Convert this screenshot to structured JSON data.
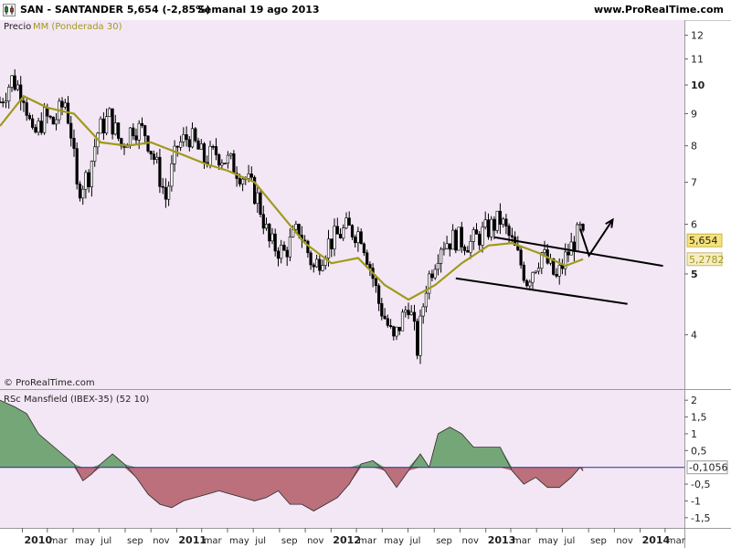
{
  "header": {
    "title": "SAN - SANTANDER    5,654 (-2,85%)",
    "period": "Semanal  19 ago 2013",
    "site": "www.ProRealTime.com"
  },
  "colors": {
    "price_bg": "#f3e7f5",
    "indicator_bg": "#f3e7f5",
    "ma": "#a09a1a",
    "candle": "#000000",
    "rs_pos": "#5e9a62",
    "rs_neg": "#b05a66",
    "zero_line": "#2a2a9a",
    "price_box": "#f5e27a",
    "ma_box": "#f6ecc6"
  },
  "price_panel": {
    "legend_prefix": "Precio",
    "legend_ma": "MM (Ponderada 30)",
    "copyright": "© ProRealTime.com",
    "last_price_label": "5,654",
    "last_ma_label": "5,2782"
  },
  "indicator_panel": {
    "legend": "RSc Mansfield (IBEX-35) (52 10)",
    "last_value_label": "-0,1056"
  },
  "chart_data": [
    {
      "type": "candlestick",
      "title": "SAN - SANTANDER",
      "y_scale": "log",
      "ylim": [
        3.3,
        12.6
      ],
      "y_ticks": [
        {
          "label": "12",
          "value": 12,
          "bold": false
        },
        {
          "label": "11",
          "value": 11,
          "bold": false
        },
        {
          "label": "10",
          "value": 10,
          "bold": true
        },
        {
          "label": "9",
          "value": 9,
          "bold": false
        },
        {
          "label": "8",
          "value": 8,
          "bold": false
        },
        {
          "label": "7",
          "value": 7,
          "bold": false
        },
        {
          "label": "6",
          "value": 6,
          "bold": false
        },
        {
          "label": "5",
          "value": 5,
          "bold": true
        },
        {
          "label": "4",
          "value": 4,
          "bold": false
        }
      ],
      "x_range": [
        "2009-11-09",
        "2014-04-07"
      ],
      "x_labels": [
        {
          "label": "2010",
          "date": "2010-01-01",
          "year": true
        },
        {
          "label": "mar",
          "date": "2010-03-01",
          "year": false
        },
        {
          "label": "may",
          "date": "2010-05-01",
          "year": false
        },
        {
          "label": "jul",
          "date": "2010-07-01",
          "year": false
        },
        {
          "label": "sep",
          "date": "2010-09-01",
          "year": false
        },
        {
          "label": "nov",
          "date": "2010-11-01",
          "year": false
        },
        {
          "label": "2011",
          "date": "2011-01-01",
          "year": true
        },
        {
          "label": "mar",
          "date": "2011-03-01",
          "year": false
        },
        {
          "label": "may",
          "date": "2011-05-01",
          "year": false
        },
        {
          "label": "jul",
          "date": "2011-07-01",
          "year": false
        },
        {
          "label": "sep",
          "date": "2011-09-01",
          "year": false
        },
        {
          "label": "nov",
          "date": "2011-11-01",
          "year": false
        },
        {
          "label": "2012",
          "date": "2012-01-01",
          "year": true
        },
        {
          "label": "mar",
          "date": "2012-03-01",
          "year": false
        },
        {
          "label": "may",
          "date": "2012-05-01",
          "year": false
        },
        {
          "label": "jul",
          "date": "2012-07-01",
          "year": false
        },
        {
          "label": "sep",
          "date": "2012-09-01",
          "year": false
        },
        {
          "label": "nov",
          "date": "2012-11-01",
          "year": false
        },
        {
          "label": "2013",
          "date": "2013-01-01",
          "year": true
        },
        {
          "label": "mar",
          "date": "2013-03-01",
          "year": false
        },
        {
          "label": "may",
          "date": "2013-05-01",
          "year": false
        },
        {
          "label": "jul",
          "date": "2013-07-01",
          "year": false
        },
        {
          "label": "sep",
          "date": "2013-09-01",
          "year": false
        },
        {
          "label": "nov",
          "date": "2013-11-01",
          "year": false
        },
        {
          "label": "2014",
          "date": "2014-01-01",
          "year": true
        },
        {
          "label": "mar",
          "date": "2014-03-01",
          "year": false
        }
      ],
      "close_series": {
        "name": "Precio",
        "points": [
          [
            "2009-11-09",
            9.4
          ],
          [
            "2009-12-07",
            10.2
          ],
          [
            "2010-01-04",
            9.7
          ],
          [
            "2010-01-25",
            8.2
          ],
          [
            "2010-02-22",
            8.9
          ],
          [
            "2010-03-15",
            8.7
          ],
          [
            "2010-04-12",
            9.4
          ],
          [
            "2010-04-26",
            8.4
          ],
          [
            "2010-05-10",
            6.8
          ],
          [
            "2010-06-07",
            7.2
          ],
          [
            "2010-06-28",
            8.4
          ],
          [
            "2010-07-26",
            8.9
          ],
          [
            "2010-08-23",
            8.0
          ],
          [
            "2010-09-20",
            8.6
          ],
          [
            "2010-10-18",
            8.4
          ],
          [
            "2010-11-15",
            7.4
          ],
          [
            "2010-12-06",
            6.6
          ],
          [
            "2011-01-03",
            8.0
          ],
          [
            "2011-01-31",
            8.3
          ],
          [
            "2011-03-07",
            7.6
          ],
          [
            "2011-04-04",
            7.8
          ],
          [
            "2011-05-09",
            7.5
          ],
          [
            "2011-06-13",
            7.1
          ],
          [
            "2011-07-11",
            6.6
          ],
          [
            "2011-08-08",
            5.6
          ],
          [
            "2011-09-12",
            5.4
          ],
          [
            "2011-10-17",
            5.9
          ],
          [
            "2011-11-21",
            5.1
          ],
          [
            "2011-12-26",
            5.6
          ],
          [
            "2012-02-06",
            5.9
          ],
          [
            "2012-03-12",
            5.8
          ],
          [
            "2012-04-23",
            4.5
          ],
          [
            "2012-05-28",
            3.9
          ],
          [
            "2012-07-02",
            4.5
          ],
          [
            "2012-07-23",
            3.8
          ],
          [
            "2012-08-13",
            4.8
          ],
          [
            "2012-09-17",
            5.6
          ],
          [
            "2012-10-22",
            5.7
          ],
          [
            "2012-11-26",
            5.6
          ],
          [
            "2013-01-07",
            5.9
          ],
          [
            "2013-02-04",
            6.1
          ],
          [
            "2013-03-04",
            5.6
          ],
          [
            "2013-04-08",
            4.9
          ],
          [
            "2013-05-13",
            5.4
          ],
          [
            "2013-06-17",
            4.9
          ],
          [
            "2013-07-08",
            5.3
          ],
          [
            "2013-08-12",
            5.85
          ],
          [
            "2013-08-19",
            5.654
          ]
        ]
      },
      "ma_series": {
        "name": "MM (Ponderada 30)",
        "points": [
          [
            "2009-11-09",
            8.6
          ],
          [
            "2010-01-04",
            9.6
          ],
          [
            "2010-03-01",
            9.2
          ],
          [
            "2010-05-03",
            9.0
          ],
          [
            "2010-07-05",
            8.1
          ],
          [
            "2010-09-06",
            8.0
          ],
          [
            "2010-11-01",
            8.1
          ],
          [
            "2011-01-03",
            7.8
          ],
          [
            "2011-03-07",
            7.5
          ],
          [
            "2011-05-02",
            7.3
          ],
          [
            "2011-07-04",
            7.0
          ],
          [
            "2011-08-29",
            6.3
          ],
          [
            "2011-10-31",
            5.6
          ],
          [
            "2012-01-02",
            5.2
          ],
          [
            "2012-03-05",
            5.3
          ],
          [
            "2012-05-07",
            4.8
          ],
          [
            "2012-07-02",
            4.55
          ],
          [
            "2012-09-03",
            4.8
          ],
          [
            "2012-11-05",
            5.2
          ],
          [
            "2013-01-07",
            5.55
          ],
          [
            "2013-03-04",
            5.6
          ],
          [
            "2013-05-06",
            5.4
          ],
          [
            "2013-07-08",
            5.15
          ],
          [
            "2013-08-19",
            5.2782
          ]
        ]
      },
      "trendlines": [
        {
          "from": [
            "2013-01-21",
            5.72
          ],
          "to": [
            "2014-02-24",
            5.15
          ]
        },
        {
          "from": [
            "2012-10-22",
            4.92
          ],
          "to": [
            "2013-12-02",
            4.48
          ]
        }
      ],
      "arrow": {
        "from": [
          "2013-09-02",
          5.35
        ],
        "via": [
          "2013-08-12",
          5.9
        ],
        "to": [
          "2013-10-28",
          6.1
        ]
      }
    },
    {
      "type": "area",
      "title": "RSc Mansfield (IBEX-35) (52 10)",
      "ylim": [
        -1.75,
        2.25
      ],
      "y_ticks": [
        {
          "label": "2",
          "value": 2
        },
        {
          "label": "1,5",
          "value": 1.5
        },
        {
          "label": "1",
          "value": 1
        },
        {
          "label": "0,5",
          "value": 0.5
        },
        {
          "label": "-0,5",
          "value": -0.5
        },
        {
          "label": "-1",
          "value": -1
        },
        {
          "label": "-1,5",
          "value": -1.5
        }
      ],
      "series": [
        {
          "points": [
            [
              "2009-11-09",
              2.0
            ],
            [
              "2009-12-14",
              1.8
            ],
            [
              "2010-01-11",
              1.6
            ],
            [
              "2010-02-08",
              1.0
            ],
            [
              "2010-03-08",
              0.7
            ],
            [
              "2010-04-05",
              0.4
            ],
            [
              "2010-05-03",
              0.1
            ],
            [
              "2010-05-24",
              -0.4
            ],
            [
              "2010-06-14",
              -0.2
            ],
            [
              "2010-07-05",
              0.1
            ],
            [
              "2010-08-02",
              0.4
            ],
            [
              "2010-08-30",
              0.1
            ],
            [
              "2010-09-27",
              -0.3
            ],
            [
              "2010-10-25",
              -0.8
            ],
            [
              "2010-11-22",
              -1.1
            ],
            [
              "2010-12-20",
              -1.2
            ],
            [
              "2011-01-17",
              -1.0
            ],
            [
              "2011-02-14",
              -0.9
            ],
            [
              "2011-03-14",
              -0.8
            ],
            [
              "2011-04-11",
              -0.7
            ],
            [
              "2011-05-09",
              -0.8
            ],
            [
              "2011-06-06",
              -0.9
            ],
            [
              "2011-07-04",
              -1.0
            ],
            [
              "2011-08-01",
              -0.9
            ],
            [
              "2011-08-29",
              -0.7
            ],
            [
              "2011-09-26",
              -1.1
            ],
            [
              "2011-10-24",
              -1.1
            ],
            [
              "2011-11-21",
              -1.3
            ],
            [
              "2011-12-19",
              -1.1
            ],
            [
              "2012-01-16",
              -0.9
            ],
            [
              "2012-02-13",
              -0.5
            ],
            [
              "2012-03-12",
              0.1
            ],
            [
              "2012-04-09",
              0.2
            ],
            [
              "2012-05-07",
              -0.1
            ],
            [
              "2012-06-04",
              -0.6
            ],
            [
              "2012-07-02",
              -0.1
            ],
            [
              "2012-07-30",
              0.4
            ],
            [
              "2012-08-20",
              0.0
            ],
            [
              "2012-09-10",
              1.0
            ],
            [
              "2012-10-08",
              1.2
            ],
            [
              "2012-11-05",
              1.0
            ],
            [
              "2012-12-03",
              0.6
            ],
            [
              "2013-01-07",
              0.6
            ],
            [
              "2013-02-04",
              0.6
            ],
            [
              "2013-03-04",
              -0.1
            ],
            [
              "2013-04-01",
              -0.5
            ],
            [
              "2013-04-29",
              -0.3
            ],
            [
              "2013-05-27",
              -0.6
            ],
            [
              "2013-06-24",
              -0.6
            ],
            [
              "2013-07-22",
              -0.3
            ],
            [
              "2013-08-12",
              0.0
            ],
            [
              "2013-08-19",
              -0.1056
            ]
          ]
        }
      ]
    }
  ]
}
